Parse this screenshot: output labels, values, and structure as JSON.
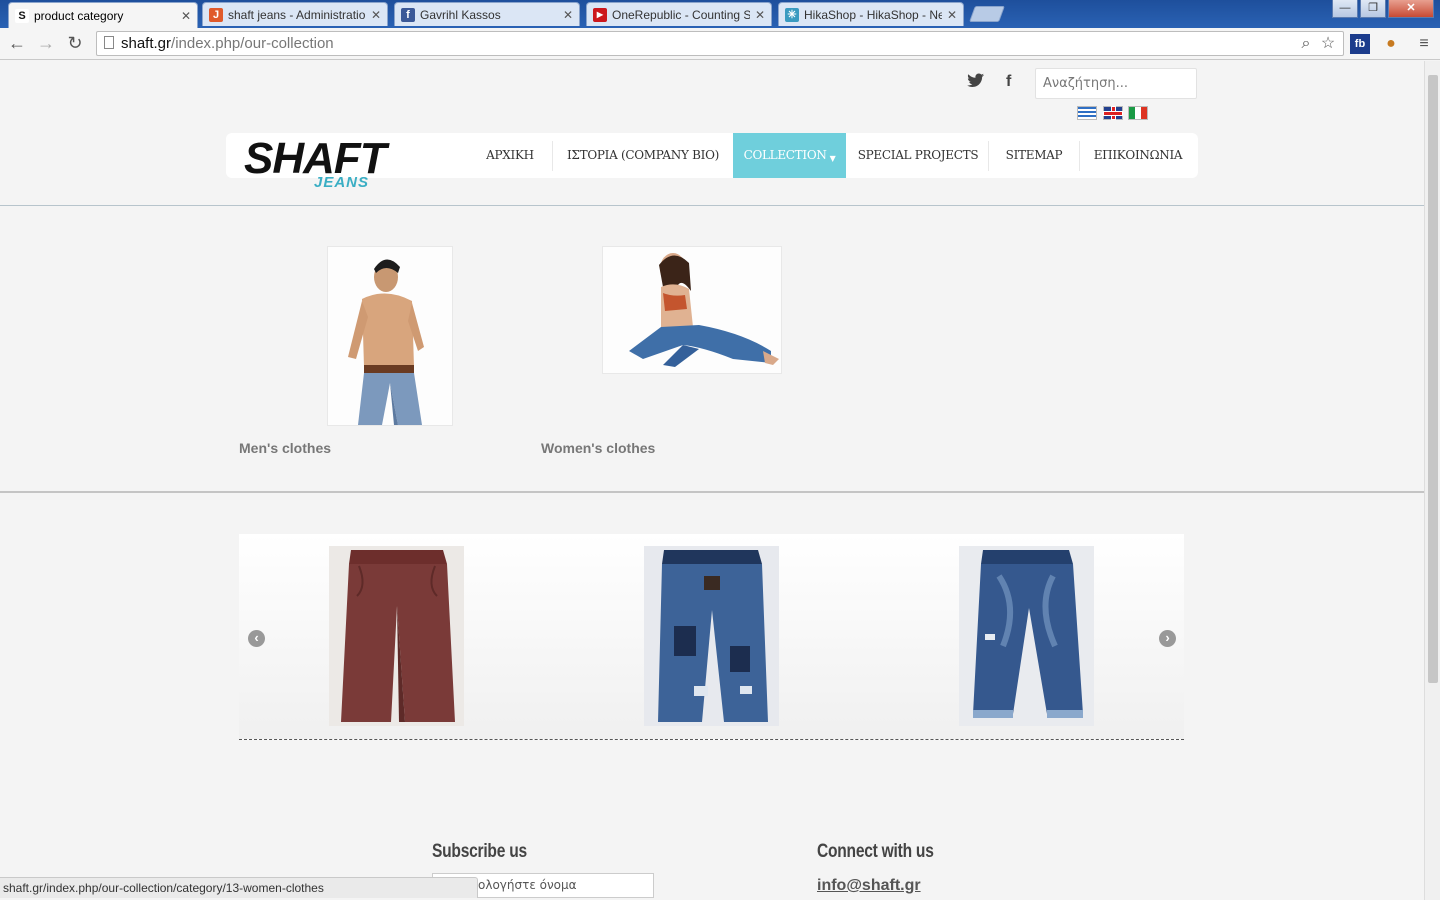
{
  "browser": {
    "tabs": [
      {
        "label": "product category",
        "favicon": "S",
        "favicon_color": "#111111",
        "active": true
      },
      {
        "label": "shaft jeans - Administratio",
        "favicon": "J",
        "favicon_color": "#e05a2a",
        "active": false
      },
      {
        "label": "Gavrihl Kassos",
        "favicon": "f",
        "favicon_color": "#3b5998",
        "active": false
      },
      {
        "label": "OneRepublic - Counting S",
        "favicon": "▶",
        "favicon_color": "#cc181e",
        "active": false
      },
      {
        "label": "HikaShop - HikaShop - Ne",
        "favicon": "✳",
        "favicon_color": "#3a9bc0",
        "active": false
      }
    ],
    "url_host": "shaft.gr",
    "url_path": "/index.php/our-collection",
    "status_url": "shaft.gr/index.php/our-collection/category/13-women-clothes"
  },
  "header": {
    "search_placeholder": "Αναζήτηση...",
    "logo_main": "SHAFT",
    "logo_sub": "JEANS",
    "menu": [
      {
        "label": "ΑΡΧΙΚΗ",
        "active": false
      },
      {
        "label": "ΙΣΤΟΡΙΑ (COMPANY BIO)",
        "active": false
      },
      {
        "label": "COLLECTION",
        "active": true
      },
      {
        "label": "SPECIAL PROJECTS",
        "active": false
      },
      {
        "label": "SITEMAP",
        "active": false
      },
      {
        "label": "ΕΠΙΚΟΙΝΩΝΙΑ",
        "active": false
      }
    ],
    "accent_color": "#6fcfdc"
  },
  "categories": [
    {
      "label": "Men's clothes"
    },
    {
      "label": "Women's clothes"
    }
  ],
  "carousel": {
    "items": [
      {
        "name": "burgundy-chinos",
        "color": "#7a3a38"
      },
      {
        "name": "patched-jeans",
        "color": "#2c4a78"
      },
      {
        "name": "distressed-jeans",
        "color": "#35588e"
      }
    ],
    "prev_glyph": "‹",
    "next_glyph": "›"
  },
  "footer": {
    "subscribe_heading": "Subscribe us",
    "subscribe_placeholder": "ολογήστε όνομα",
    "connect_heading": "Connect with us",
    "email": "info@shaft.gr"
  }
}
